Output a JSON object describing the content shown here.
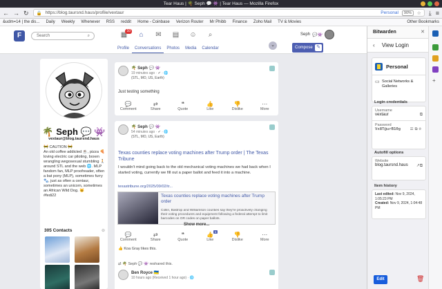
{
  "window": {
    "title": "Tear Haus | 🌴 Seph 💬 👾 | Tear Haus — Mozilla Firefox"
  },
  "browser": {
    "url": "https://blog.taursnd.haus/profile/vextaur",
    "persona": "Personal",
    "zoom": "90%",
    "bookmarks": [
      "&udm=14 | the dis...",
      "Daily",
      "Weekly",
      "Whenever",
      "RSS",
      "reddit",
      "Home - Coinbase",
      "Verizon Router",
      "Mr Phibb",
      "Finance",
      "Zoho Mail",
      "TV & Movies",
      "Other Bookmarks"
    ]
  },
  "app": {
    "search_placeholder": "Search",
    "notif_badge": "10",
    "tabs": [
      "Profile",
      "Conversations",
      "Photos",
      "Media",
      "Calendar"
    ],
    "user_short": "Seph",
    "compose_label": "Compose"
  },
  "profile": {
    "name": "🌴 Seph 💬 👾",
    "handle": "vextaur@blog.taursnd.haus",
    "bio": "🚧 CAUTION 🚧\nAn old coffee addicted ☕, pizza 🍕 loving electric car piloting, boxen wrangling wegosexual stumbling 🚶 around STL and the web 🌐. MLP fandom fan, MLP proofreader, often a bat pony (MLP), sometimes furry 🐾, just as often a centaur, sometimes an unicorn, sometimes an African Wild Dog. 😼\n#fedi22"
  },
  "contacts": {
    "title": "305 Contacts"
  },
  "posts": [
    {
      "author": "🌴 Seph 💬 👾",
      "meta": "19 minutes ago · ✔ · 🌐",
      "location": "(STL, MO, US, Earth)",
      "text": "Just testing something",
      "actions": [
        "Comment",
        "Share",
        "Quote",
        "Like",
        "Dislike",
        "More"
      ]
    },
    {
      "author": "🌴 Seph 💬 👾",
      "meta": "54 minutes ago · ✔ · 🌐",
      "location": "(STL, MO, US, Earth)",
      "title": "Texas counties replace voting machines after Trump order | The Texas Tribune",
      "body": "I wouldn't mind going back to the old mechanical voting machines we had back when I started voting, currently we fill out a paper ballot and feed it into a machine.",
      "link": "texastribune.org/2025/09/02/tr...",
      "card_title": "Texas counties replace voting machines after Trump order",
      "card_body": "Collin, Bastrop and Williamson counties say they're proactively changing their voting procedures and equipment following a federal attempt to limit barcodes on OR codes on paper ballots.",
      "show_more": "Show more...",
      "like_count": "1",
      "liked_by": "Koa Gray likes this.",
      "actions": [
        "Comment",
        "Share",
        "Quote",
        "Like",
        "Dislike",
        "More"
      ]
    },
    {
      "reshared_by": "🌴 Seph 💬 👾 reshared this.",
      "author": "Ben Royce 🇺🇦",
      "meta": "10 hours ago (Received 1 hour ago) · 🌐"
    }
  ],
  "bitwarden": {
    "title": "Bitwarden",
    "view_title": "View Login",
    "item_name": "Personal",
    "folder": "Social Networks & Galleries",
    "credentials_label": "Login credentials",
    "username_label": "Username",
    "username": "vextaur",
    "password_label": "Password",
    "password": "Vx8T@urB10g",
    "autofill_label": "Autofill options",
    "website_label": "Website",
    "website": "blog.taursnd.haus",
    "history_label": "Item history",
    "last_edited_label": "Last edited:",
    "last_edited": "Nov 9, 2024, 1:05:23 PM",
    "created_label": "Created:",
    "created": "Nov 9, 2024, 1:04:48 PM",
    "edit_label": "Edit"
  }
}
